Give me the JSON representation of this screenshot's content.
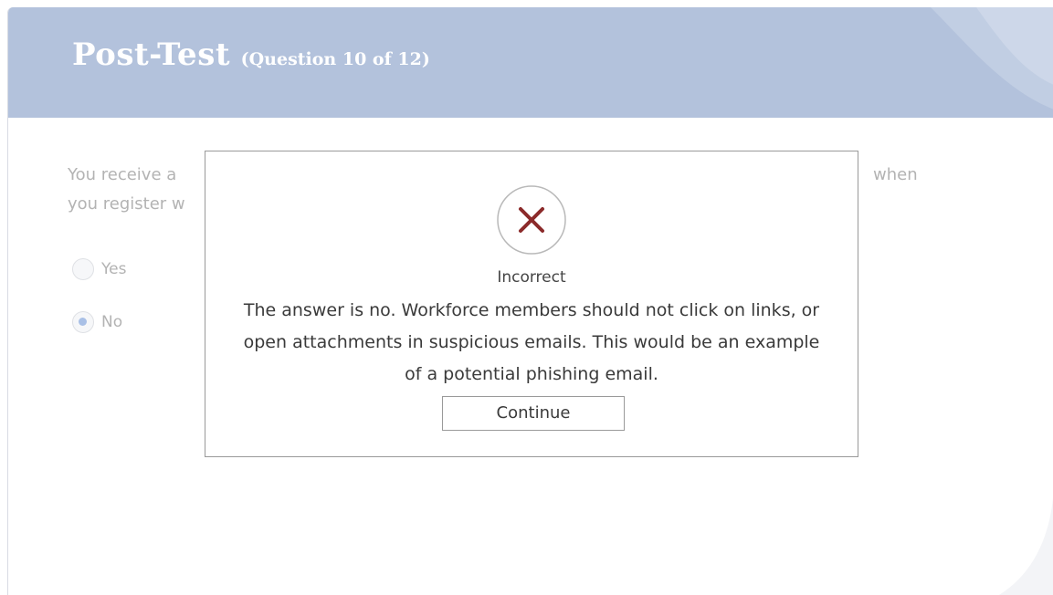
{
  "header": {
    "title": "Post-Test",
    "subtitle": "(Question 10 of 12)"
  },
  "question": {
    "line1_start": "You receive a",
    "line1_end": "when",
    "line2_start": "you register w"
  },
  "options": [
    {
      "label": "Yes",
      "selected": false
    },
    {
      "label": "No",
      "selected": true
    }
  ],
  "feedback": {
    "status": "Incorrect",
    "message": "The answer is no. Workforce members should not click on links, or open attachments in suspicious emails. This would be an example of a potential phishing email.",
    "continue_label": "Continue",
    "icon": "x-mark-icon"
  },
  "colors": {
    "header_bg": "#b3c2dc",
    "title": "#ffffff",
    "x_mark": "#8b2a2a",
    "radio_selected": "#a9c0e6",
    "text_faded": "#b3b3b3"
  }
}
